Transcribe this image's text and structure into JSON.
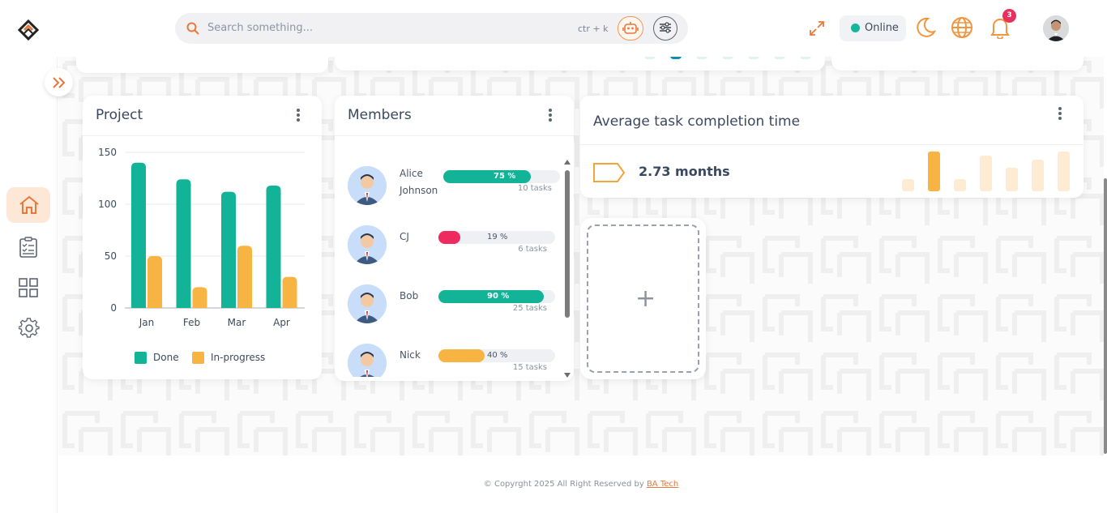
{
  "topbar": {
    "search_placeholder": "Search something...",
    "shortcut": "ctr + k",
    "status_label": "Online",
    "notification_count": "3"
  },
  "project_card": {
    "title": "Project",
    "chart_data": {
      "type": "bar",
      "categories": [
        "Jan",
        "Feb",
        "Mar",
        "Apr"
      ],
      "series": [
        {
          "name": "Done",
          "values": [
            140,
            124,
            112,
            118
          ],
          "color": "#13b398"
        },
        {
          "name": "In-progress",
          "values": [
            50,
            20,
            60,
            30
          ],
          "color": "#f8b442"
        }
      ],
      "y_ticks": [
        0,
        50,
        100,
        150
      ],
      "ylim": [
        0,
        150
      ],
      "grid": true,
      "legend_position": "bottom"
    }
  },
  "members_card": {
    "title": "Members",
    "members": [
      {
        "name": "Alice Johnson",
        "percent": 75,
        "percent_label": "75 %",
        "tasks": "10 tasks",
        "color": "#13b398"
      },
      {
        "name": "CJ",
        "percent": 19,
        "percent_label": "19 %",
        "tasks": "6 tasks",
        "color": "#ee2a5e"
      },
      {
        "name": "Bob",
        "percent": 90,
        "percent_label": "90 %",
        "tasks": "25 tasks",
        "color": "#13b398"
      },
      {
        "name": "Nick",
        "percent": 40,
        "percent_label": "40 %",
        "tasks": "15 tasks",
        "color": "#f8b442"
      }
    ]
  },
  "avg_card": {
    "title": "Average task completion time",
    "value": "2.73 months",
    "accent": "#f3a53a"
  },
  "add_card": {
    "plus": "+"
  },
  "footer": {
    "text": "© Copyrght 2025 All Right Reserved by",
    "link": "BA Tech"
  },
  "colors": {
    "brand": "#e9783a",
    "online": "#14b79b",
    "badge": "#e8305c"
  }
}
